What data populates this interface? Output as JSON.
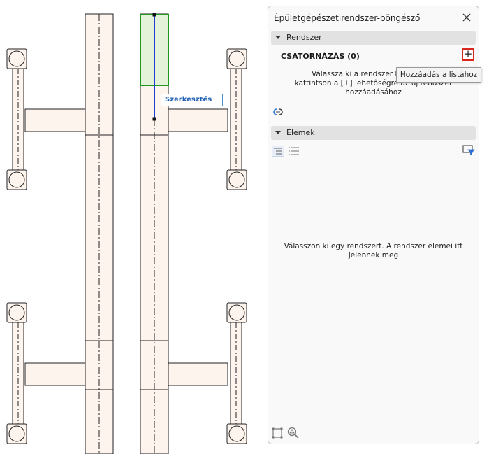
{
  "panel": {
    "title": "Épületgépészetirendszer-böngésző",
    "sections": {
      "system": "Rendszer",
      "elements": "Elemek"
    },
    "system_name": "CSATORNÁZÁS (0)",
    "add_symbol": "+",
    "hint_lines": [
      "Válassza ki a rendszer kezdőpontj",
      "kattintson a [+] lehetőségre az új rendszer",
      "hozzáadásához"
    ],
    "empty_lines": [
      "Válasszon ki egy rendszert. A rendszer elemei itt",
      "jelennek meg"
    ]
  },
  "tooltip": "Hozzáadás a listához",
  "canvas": {
    "edit_label": "Szerkesztés"
  },
  "icons": {
    "close": "close-icon",
    "add": "plus-icon",
    "link": "link-icon",
    "tree_view": "tree-view-icon",
    "list_view": "list-view-icon",
    "filter": "filter-icon",
    "select_frame": "select-frame-icon",
    "zoom_to": "zoom-to-icon"
  },
  "colors": {
    "pipe_fill": "#fdf4ee",
    "selection_green": "#1f9a1f",
    "selection_fill": "#e4f2d9",
    "edit_blue": "#1e5fb4",
    "add_border": "#d9261c"
  }
}
